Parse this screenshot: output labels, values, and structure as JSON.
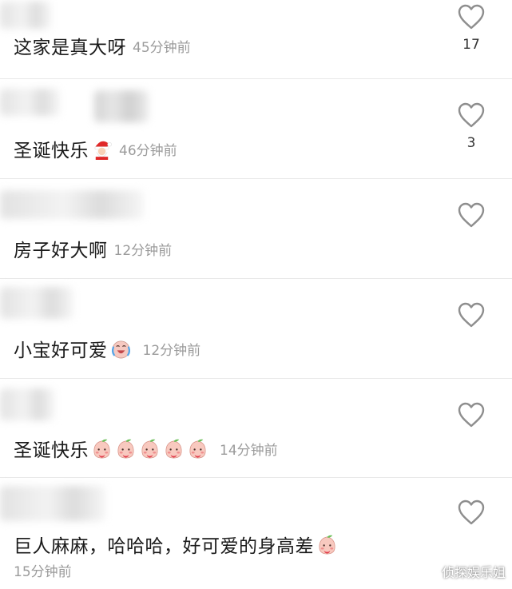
{
  "comments": [
    {
      "text": "这家是真大呀",
      "time": "45分钟前",
      "likes": "17",
      "emojis": []
    },
    {
      "text": "圣诞快乐",
      "time": "46分钟前",
      "likes": "3",
      "emojis": [
        "santa-emoji"
      ]
    },
    {
      "text": "房子好大啊",
      "time": "12分钟前",
      "likes": "",
      "emojis": []
    },
    {
      "text": "小宝好可爱",
      "time": "12分钟前",
      "likes": "",
      "emojis": [
        "crying-laugh-emoji"
      ]
    },
    {
      "text": "圣诞快乐",
      "time": "14分钟前",
      "likes": "",
      "emojis": [
        "peach-emoji",
        "peach-emoji",
        "peach-emoji",
        "peach-emoji",
        "peach-emoji"
      ]
    },
    {
      "text": "巨人麻麻，哈哈哈，好可爱的身高差",
      "time": "15分钟前",
      "likes": "",
      "emojis": [
        "peach-emoji"
      ]
    }
  ],
  "watermark": "侦探娱乐姐",
  "icons": {
    "like": "heart-outline-icon"
  }
}
